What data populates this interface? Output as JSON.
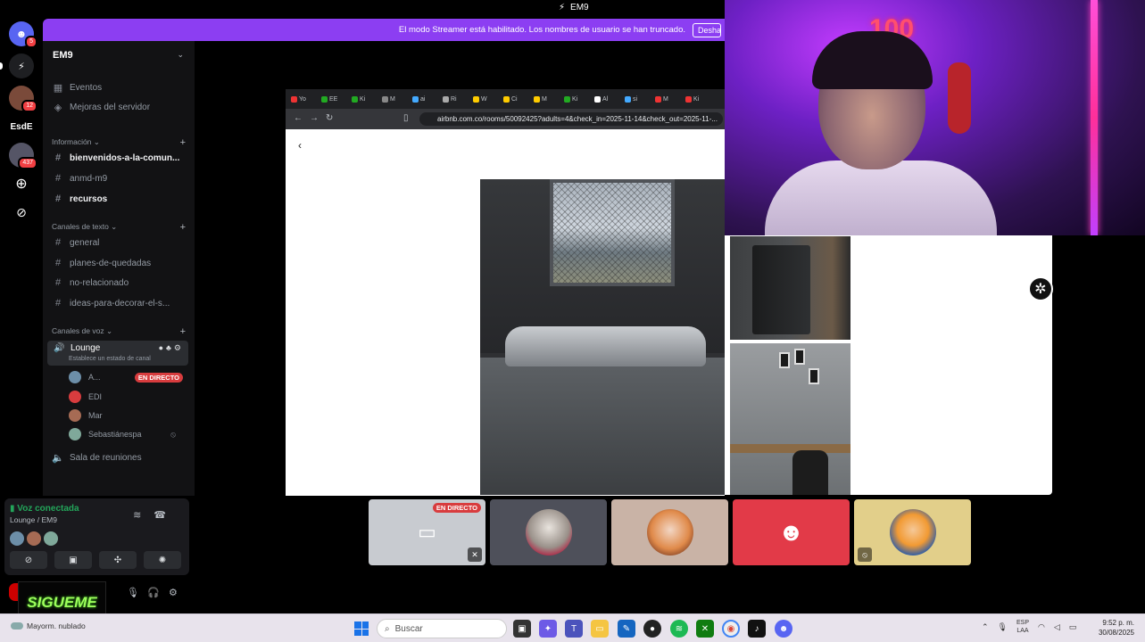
{
  "topbar": {
    "title": "EM9"
  },
  "banner": {
    "message": "El modo Streamer está habilitado. Los nombres de usuario se han truncado.",
    "button": "Deshabilitar"
  },
  "rail": {
    "badges": {
      "first": "5",
      "third": "12",
      "fifth": "437"
    },
    "text_server": "EsdE"
  },
  "server": {
    "name": "EM9"
  },
  "sidebar": {
    "top_items": [
      {
        "label": "Eventos",
        "icon": "calendar-icon"
      },
      {
        "label": "Mejoras del servidor",
        "icon": "boost-icon"
      }
    ],
    "categories": {
      "info": "Información",
      "text": "Canales de texto",
      "voice": "Canales de voz"
    },
    "info_channels": [
      "bienvenidos-a-la-comun...",
      "anmd-m9",
      "recursos"
    ],
    "text_channels": [
      "general",
      "planes-de-quedadas",
      "no-relacionado",
      "ideas-para-decorar-el-s..."
    ],
    "voice_channel": {
      "name": "Lounge",
      "status": "Establece un estado de canal"
    },
    "voice_users": [
      {
        "name": "A...",
        "live": "EN DIRECTO"
      },
      {
        "name": "EDI"
      },
      {
        "name": "Mar"
      },
      {
        "name": "Sebastiánespa"
      }
    ],
    "meeting_room": "Sala de reuniones"
  },
  "voice_panel": {
    "connected": "Voz conectada",
    "location": "Lounge / EM9"
  },
  "overlay": {
    "sigueme": "SIGUEME"
  },
  "browser": {
    "tabs": [
      "Yo",
      "EE",
      "Ki",
      "M",
      "ai",
      "Ri",
      "W",
      "Ci",
      "M",
      "Ki",
      "Al",
      "si",
      "M",
      "Ki"
    ],
    "url": "airbnb.com.co/rooms/50092425?adults=4&check_in=2025-11-14&check_out=2025-11-..."
  },
  "tiles": {
    "live": "EN DIRECTO"
  },
  "taskbar": {
    "weather": "Mayorm. nublado",
    "search": "Buscar",
    "lang_top": "ESP",
    "lang_bottom": "LAA",
    "time": "9:52 p. m.",
    "date": "30/08/2025"
  },
  "colors": {
    "discord_blurple": "#5865f2",
    "banner_purple": "#8c3ef2",
    "live_red": "#d83c3e",
    "connected_green": "#23a55a"
  }
}
